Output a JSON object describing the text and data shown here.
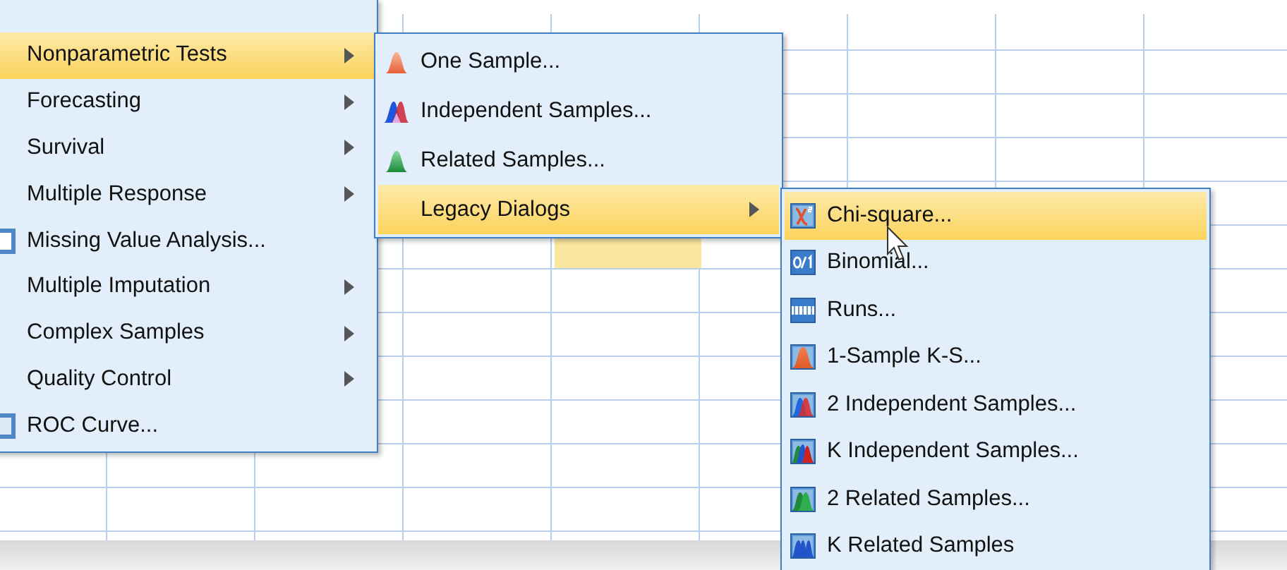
{
  "menus": [
    {
      "items": [
        {
          "label": "Nonparametric Tests",
          "has_submenu": true,
          "selected": true,
          "icon": false
        },
        {
          "label": "Forecasting",
          "has_submenu": true,
          "selected": false,
          "icon": false
        },
        {
          "label": "Survival",
          "has_submenu": true,
          "selected": false,
          "icon": false
        },
        {
          "label": "Multiple Response",
          "has_submenu": true,
          "selected": false,
          "icon": false
        },
        {
          "label": "Missing Value Analysis...",
          "has_submenu": false,
          "selected": false,
          "icon": true
        },
        {
          "label": "Multiple Imputation",
          "has_submenu": true,
          "selected": false,
          "icon": false
        },
        {
          "label": "Complex Samples",
          "has_submenu": true,
          "selected": false,
          "icon": false
        },
        {
          "label": "Quality Control",
          "has_submenu": true,
          "selected": false,
          "icon": false
        },
        {
          "label": "ROC Curve...",
          "has_submenu": false,
          "selected": false,
          "icon": true
        }
      ]
    },
    {
      "items": [
        {
          "label": "One Sample...",
          "has_submenu": false,
          "selected": false,
          "icon": true
        },
        {
          "label": "Independent Samples...",
          "has_submenu": false,
          "selected": false,
          "icon": true
        },
        {
          "label": "Related Samples...",
          "has_submenu": false,
          "selected": false,
          "icon": true
        },
        {
          "label": "Legacy Dialogs",
          "has_submenu": true,
          "selected": true,
          "icon": false
        }
      ]
    },
    {
      "items": [
        {
          "label": "Chi-square...",
          "has_submenu": false,
          "selected": true,
          "icon": true
        },
        {
          "label": "Binomial...",
          "has_submenu": false,
          "selected": false,
          "icon": true
        },
        {
          "label": "Runs...",
          "has_submenu": false,
          "selected": false,
          "icon": true
        },
        {
          "label": "1-Sample K-S...",
          "has_submenu": false,
          "selected": false,
          "icon": true
        },
        {
          "label": "2 Independent Samples...",
          "has_submenu": false,
          "selected": false,
          "icon": true
        },
        {
          "label": "K Independent Samples...",
          "has_submenu": false,
          "selected": false,
          "icon": true
        },
        {
          "label": "2 Related Samples...",
          "has_submenu": false,
          "selected": false,
          "icon": true
        },
        {
          "label": "K Related Samples",
          "has_submenu": false,
          "selected": false,
          "icon": true
        }
      ]
    }
  ]
}
